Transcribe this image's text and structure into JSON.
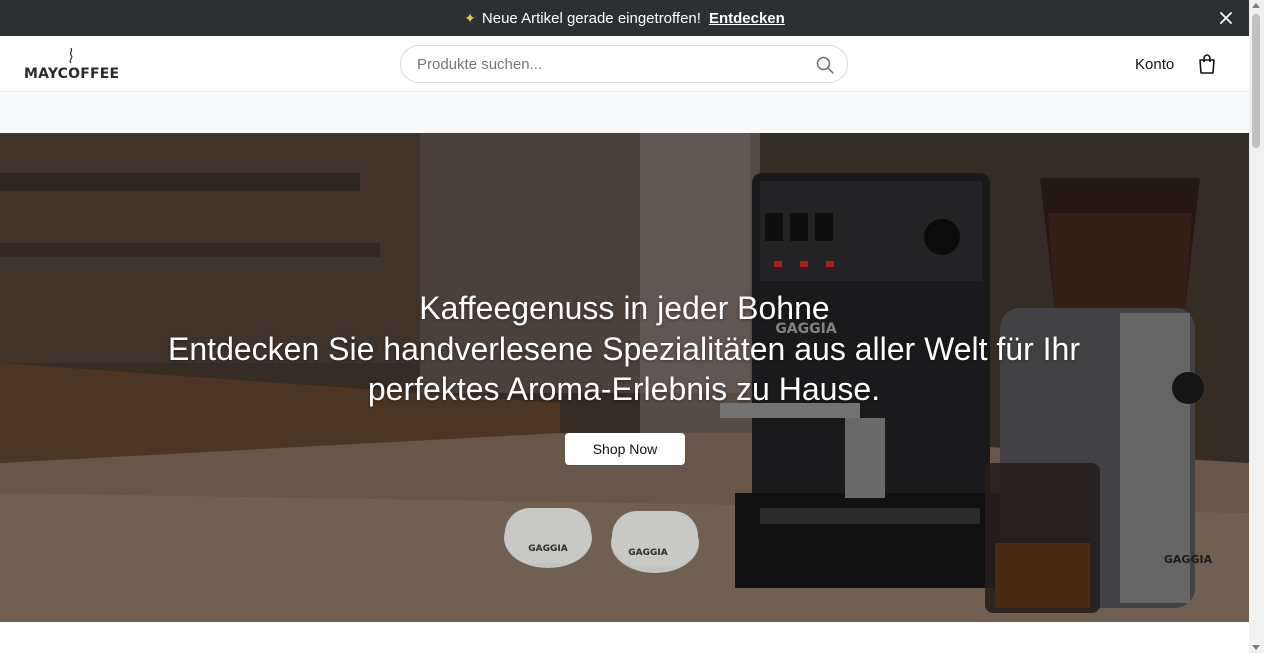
{
  "announcement": {
    "text": "Neue Artikel gerade eingetroffen!",
    "cta": "Entdecken",
    "icon": "sparkle-icon"
  },
  "header": {
    "logo_text": "MAYCOFFEE",
    "search": {
      "placeholder": "Produkte suchen...",
      "value": ""
    },
    "account_label": "Konto",
    "cart_icon": "shopping-bag-icon"
  },
  "hero": {
    "title": "Kaffeegenuss in jeder Bohne",
    "subtitle": "Entdecken Sie handverlesene Spezialitäten aus aller Welt für Ihr perfektes Aroma-Erlebnis zu Hause.",
    "cta": "Shop Now",
    "image_label": "GAGGIA"
  },
  "colors": {
    "announcement_bg": "#2a3132",
    "accent": "#f5c54a",
    "nav_strip_bg": "#f8f9fb"
  }
}
